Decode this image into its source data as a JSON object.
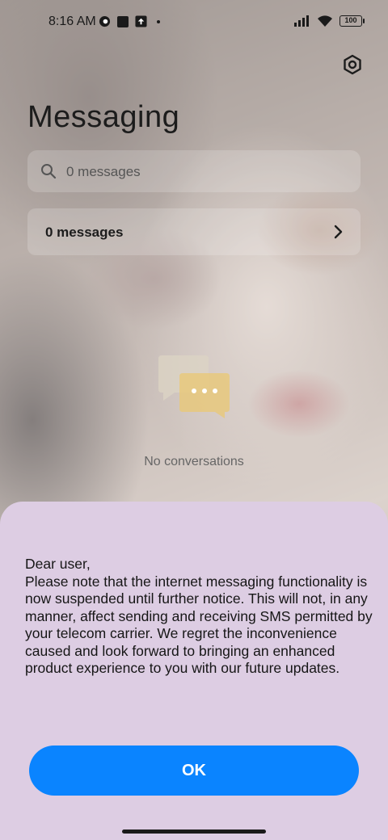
{
  "status_bar": {
    "time": "8:16 AM",
    "battery": "100"
  },
  "app": {
    "title": "Messaging"
  },
  "search": {
    "placeholder": "0 messages"
  },
  "messages_row": {
    "label": "0 messages"
  },
  "empty_state": {
    "text": "No conversations"
  },
  "dialog": {
    "lines": [
      "Dear user,",
      "Please note that the internet messaging functionality is now suspended until further notice. This will not, in any manner, affect sending and receiving SMS permitted by your telecom carrier. We regret the inconvenience caused and look forward to bringing an enhanced product experience to you with our future updates."
    ],
    "ok_label": "OK"
  },
  "colors": {
    "accent": "#0a84ff",
    "sheet_background": "#ddcde3"
  },
  "icons": [
    "signal-icon",
    "wifi-icon",
    "battery-icon",
    "settings-icon",
    "search-icon",
    "chevron-right-icon",
    "chat-bubbles-icon"
  ]
}
